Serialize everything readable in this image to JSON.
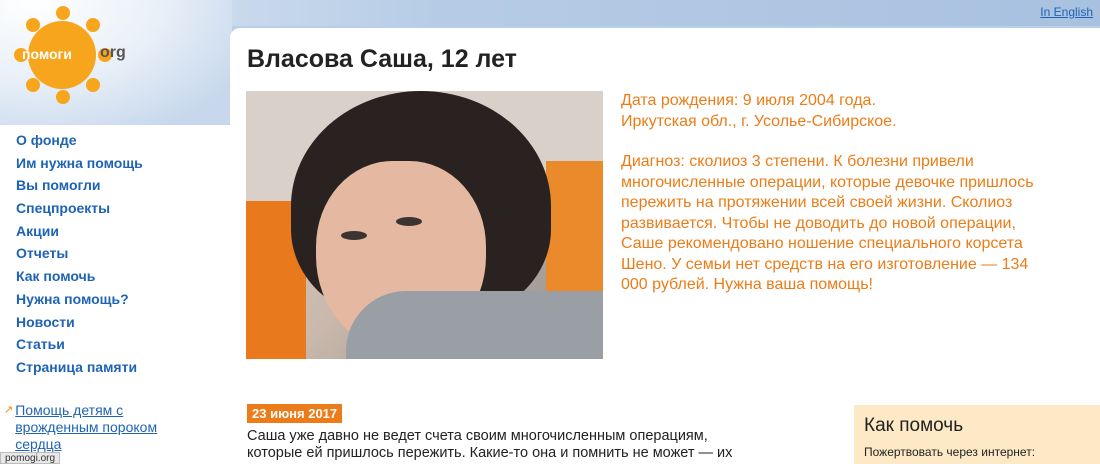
{
  "header": {
    "language_link": "In English"
  },
  "logo": {
    "text": "помоги",
    "suffix": "org",
    "color": "#f7a51d"
  },
  "nav": {
    "items": [
      {
        "label": "О фонде"
      },
      {
        "label": "Им нужна помощь"
      },
      {
        "label": "Вы помогли"
      },
      {
        "label": "Спецпроекты"
      },
      {
        "label": "Акции"
      },
      {
        "label": "Отчеты"
      },
      {
        "label": "Как помочь"
      },
      {
        "label": "Нужна помощь?"
      },
      {
        "label": "Новости"
      },
      {
        "label": "Статьи"
      },
      {
        "label": "Страница памяти"
      }
    ]
  },
  "promo": {
    "link": "Помощь детям с врожденным пороком сердца"
  },
  "status_bar": {
    "url": "pomogi.org"
  },
  "main": {
    "title": "Власова Саша, 12 лет",
    "photo_alt": "",
    "info": {
      "birth": "Дата рождения: 9 июля 2004 года.",
      "location": "Иркутская обл., г. Усолье-Сибирское.",
      "diagnosis": "Диагноз: сколиоз 3 степени. К болезни привели многочисленные операции, которые девочке пришлось пережить на протяжении всей своей жизни. Сколиоз развивается. Чтобы не доводить до новой операции, Саше рекомендовано ношение специального корсета Шено. У семьи нет средств на его изготовление — 134 000 рублей. Нужна ваша помощь!"
    },
    "date_badge": "23 июня 2017",
    "story": "Саша уже давно не ведет счета своим многочисленным операциям, которые ей пришлось пережить. Какие-то она и помнить не может — их делали, когда"
  },
  "how_to_help": {
    "title": "Как помочь",
    "subtitle": "Пожертвовать через интернет:"
  },
  "colors": {
    "accent": "#ec7c17",
    "link": "#1e63b4",
    "background": "#b9cfe8"
  }
}
